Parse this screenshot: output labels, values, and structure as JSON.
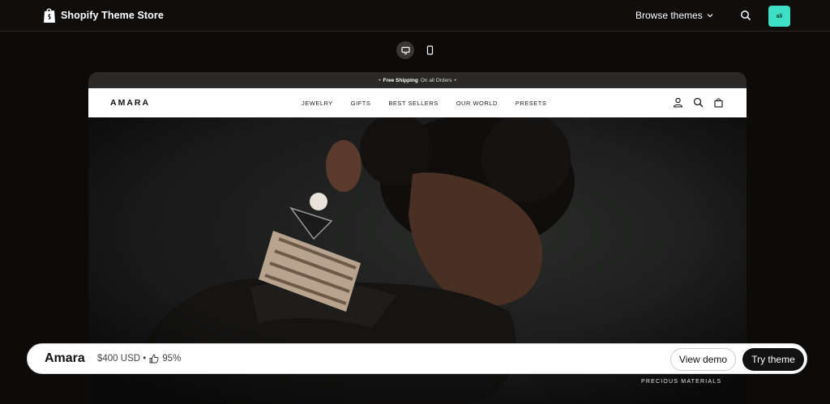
{
  "topbar": {
    "brand_text": "Shopify Theme Store",
    "browse_label": "Browse themes",
    "avatar_initials": "ali",
    "avatar_color": "#3de0c6"
  },
  "device_toggle": {
    "options": [
      "desktop-icon",
      "mobile-icon"
    ],
    "selected": "desktop"
  },
  "preview": {
    "announcement": {
      "bold": "Free Shipping",
      "rest": "On all Orders"
    },
    "shop_logo": "AMARA",
    "nav": [
      "JEWELRY",
      "GIFTS",
      "BEST SELLERS",
      "OUR WORLD",
      "PRESETS"
    ],
    "header_icons": [
      "account-icon",
      "search-icon",
      "cart-icon"
    ],
    "hero_caption": "PRECIOUS MATERIALS"
  },
  "bottombar": {
    "theme_name": "Amara",
    "price": "$400 USD •",
    "rating": "95%",
    "view_demo_label": "View demo",
    "try_theme_label": "Try theme"
  }
}
